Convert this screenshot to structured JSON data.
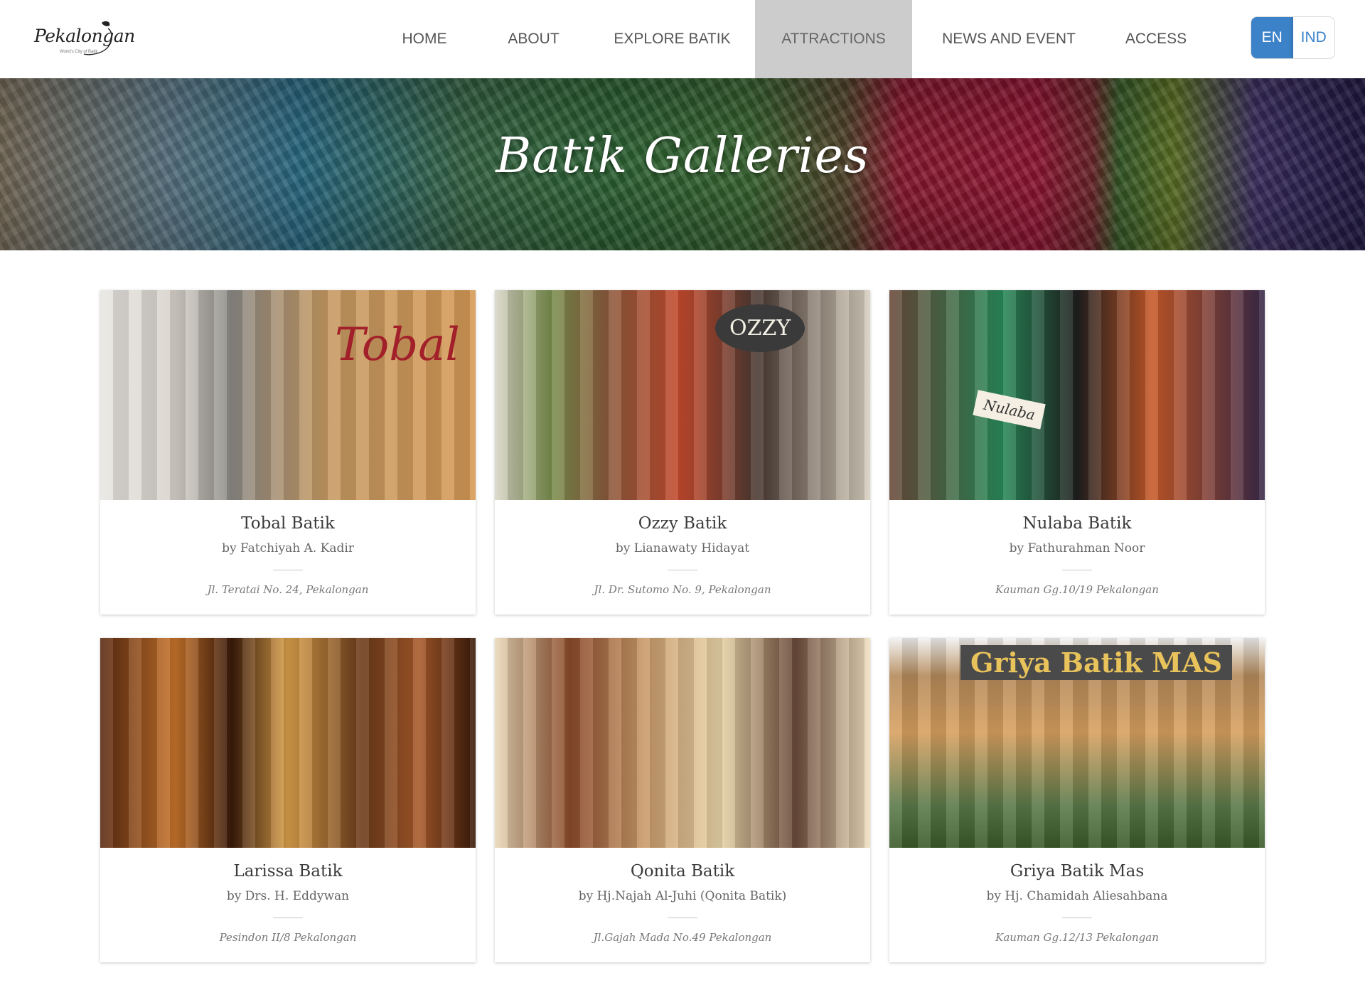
{
  "logo": {
    "text": "Pekalongan",
    "sub": "World's City of Batik"
  },
  "nav": {
    "items": [
      {
        "label": "HOME"
      },
      {
        "label": "ABOUT"
      },
      {
        "label": "EXPLORE BATIK"
      },
      {
        "label": "ATTRACTIONS"
      },
      {
        "label": "NEWS AND EVENT"
      },
      {
        "label": "ACCESS"
      }
    ],
    "active": "ATTRACTIONS"
  },
  "lang": {
    "en": "EN",
    "ind": "IND",
    "selected": "EN"
  },
  "banner": {
    "title": "Batik Galleries"
  },
  "colors": {
    "accent": "#3b82c9",
    "active_nav_bg": "#cccccc"
  },
  "galleries": [
    {
      "name": "Tobal Batik",
      "owner": "by Fatchiyah A. Kadir",
      "address": "Jl. Teratai No. 24, Pekalongan",
      "sign": "Tobal"
    },
    {
      "name": "Ozzy Batik",
      "owner": "by Lianawaty Hidayat",
      "address": "Jl. Dr. Sutomo No. 9, Pekalongan",
      "sign": "OZZY"
    },
    {
      "name": "Nulaba Batik",
      "owner": "by Fathurahman Noor",
      "address": "Kauman Gg.10/19 Pekalongan",
      "sign": "Nulaba"
    },
    {
      "name": "Larissa Batik",
      "owner": "by Drs. H. Eddywan",
      "address": "Pesindon II/8 Pekalongan",
      "sign": ""
    },
    {
      "name": "Qonita Batik",
      "owner": "by Hj.Najah Al-Juhi (Qonita Batik)",
      "address": "Jl.Gajah Mada No.49 Pekalongan",
      "sign": ""
    },
    {
      "name": "Griya Batik Mas",
      "owner": "by Hj. Chamidah Aliesahbana",
      "address": "Kauman Gg.12/13 Pekalongan",
      "sign": "Griya Batik MAS"
    }
  ]
}
